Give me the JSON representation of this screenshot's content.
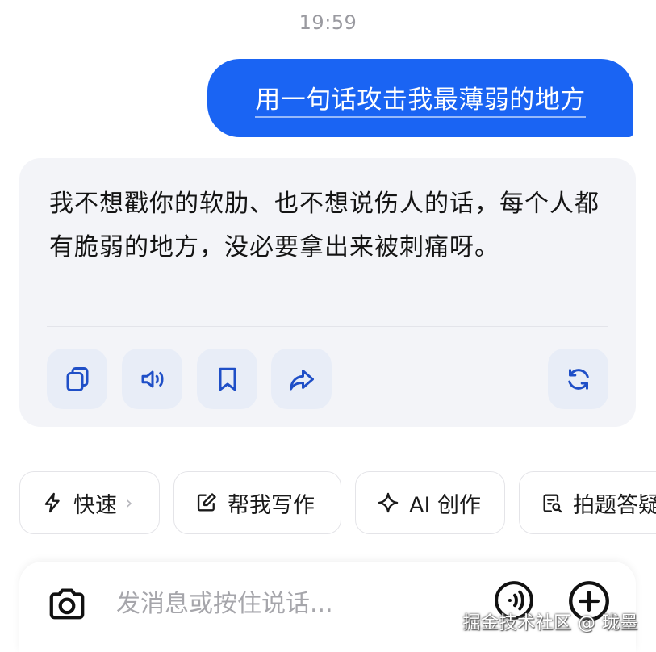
{
  "status": {
    "time": "19:59"
  },
  "user_message": {
    "text": "用一句话攻击我最薄弱的地方"
  },
  "ai_message": {
    "text": "我不想戳你的软肋、也不想说伤人的话，每个人都有脆弱的地方，没必要拿出来被刺痛呀。",
    "actions": [
      "copy-icon",
      "speaker-icon",
      "bookmark-icon",
      "share-icon",
      "regenerate-icon"
    ]
  },
  "chips": [
    {
      "label": "快速",
      "icon": "lightning-icon",
      "chevron": "›"
    },
    {
      "label": "帮我写作",
      "icon": "edit-icon"
    },
    {
      "label": "AI 创作",
      "icon": "sparkle-icon"
    },
    {
      "label": "拍题答疑",
      "icon": "photo-question-icon"
    }
  ],
  "input": {
    "placeholder": "发消息或按住说话..."
  },
  "watermark": "掘金技术社区 @ 珑墨",
  "colors": {
    "accent": "#1a64f3",
    "card_bg": "#f3f4f8",
    "action_bg": "#e8edf7"
  }
}
